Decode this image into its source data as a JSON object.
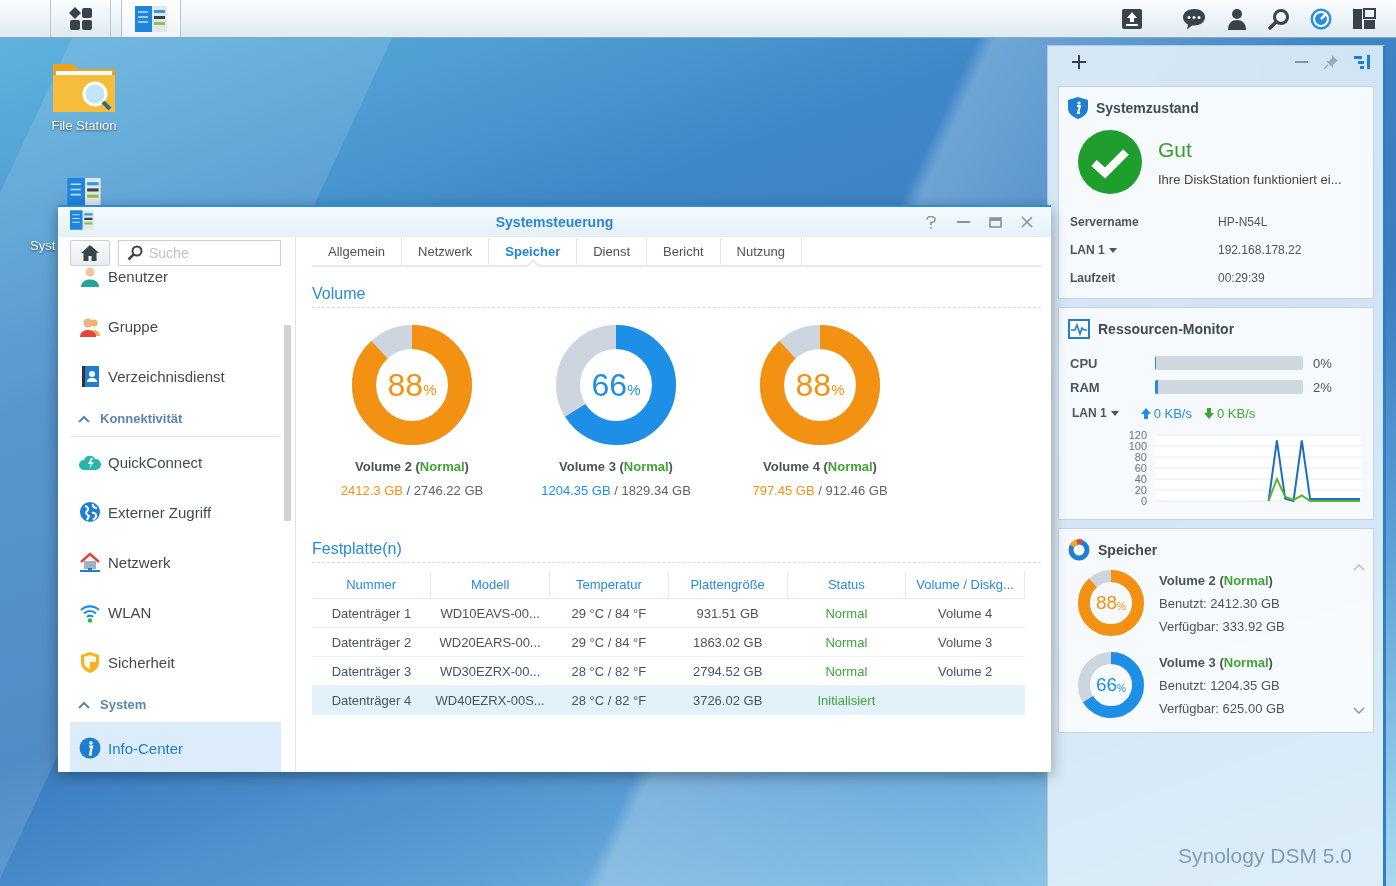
{
  "desktop": {
    "icons": [
      {
        "label": "File Station",
        "kind": "folder"
      },
      {
        "label": "Syst",
        "kind": "control-panel"
      }
    ],
    "brand": "Synology DSM 5.0"
  },
  "window": {
    "title": "Systemsteuerung",
    "search": {
      "placeholder": "Suche"
    },
    "sidebar": {
      "items": [
        {
          "kind": "item",
          "label": "Benutzer",
          "selected": false
        },
        {
          "kind": "item",
          "label": "Gruppe",
          "selected": false
        },
        {
          "kind": "item",
          "label": "Verzeichnisdienst",
          "selected": false
        },
        {
          "kind": "header",
          "label": "Konnektivität",
          "expanded": true
        },
        {
          "kind": "item",
          "label": "QuickConnect",
          "selected": false
        },
        {
          "kind": "item",
          "label": "Externer Zugriff",
          "selected": false
        },
        {
          "kind": "item",
          "label": "Netzwerk",
          "selected": false
        },
        {
          "kind": "item",
          "label": "WLAN",
          "selected": false
        },
        {
          "kind": "item",
          "label": "Sicherheit",
          "selected": false
        },
        {
          "kind": "header",
          "label": "System",
          "expanded": true
        },
        {
          "kind": "item",
          "label": "Info-Center",
          "selected": true
        }
      ]
    },
    "tabs": [
      {
        "label": "Allgemein",
        "selected": false
      },
      {
        "label": "Netzwerk",
        "selected": false
      },
      {
        "label": "Speicher",
        "selected": true
      },
      {
        "label": "Dienst",
        "selected": false
      },
      {
        "label": "Bericht",
        "selected": false
      },
      {
        "label": "Nutzung",
        "selected": false
      }
    ],
    "volume_section": {
      "title": "Volume",
      "volumes": [
        {
          "name": "Volume 2 (*Normal*)",
          "percent": "88",
          "unit": "%",
          "level": 0.88,
          "color": "#f39212",
          "usage": "*2412.3 GB* / 2746.22 GB"
        },
        {
          "name": "Volume 3 (*Normal*)",
          "percent": "66",
          "unit": "%",
          "level": 0.66,
          "color": "#1e8fe6",
          "usage": "*1204.35 GB* / 1829.34 GB"
        },
        {
          "name": "Volume 4 (*Normal*)",
          "percent": "88",
          "unit": "%",
          "level": 0.88,
          "color": "#f39212",
          "usage": "*797.45 GB* / 912.46 GB"
        }
      ]
    },
    "disk_section": {
      "title": "Festplatte(n)",
      "table": {
        "columns": [
          "Nummer",
          "Modell",
          "Temperatur",
          "Plattengröße",
          "Status",
          "Volume / Diskg..."
        ],
        "rows": [
          {
            "cells": [
              "Datenträger 1",
              "WD10EAVS-00...",
              "29 °C / 84 °F",
              "931.51 GB",
              "Normal",
              "Volume 4"
            ],
            "selected": false
          },
          {
            "cells": [
              "Datenträger 2",
              "WD20EARS-00...",
              "29 °C / 84 °F",
              "1863.02 GB",
              "Normal",
              "Volume 3"
            ],
            "selected": false
          },
          {
            "cells": [
              "Datenträger 3",
              "WD30EZRX-00...",
              "28 °C / 82 °F",
              "2794.52 GB",
              "Normal",
              "Volume 2"
            ],
            "selected": false
          },
          {
            "cells": [
              "Datenträger 4",
              "WD40EZRX-00S...",
              "28 °C / 82 °F",
              "3726.02 GB",
              "Initialisiert"
            ],
            "selected": true
          }
        ]
      }
    }
  },
  "widgets": {
    "health": {
      "title": "Systemzustand",
      "status": "Gut",
      "message": "Ihre DiskStation funktioniert ei...",
      "rows": [
        {
          "label": "Servername",
          "value": "HP-N54L",
          "dropdown": false
        },
        {
          "label": "LAN 1",
          "value": "192.168.178.22",
          "dropdown": true
        },
        {
          "label": "Laufzeit",
          "value": "00:29:39",
          "dropdown": false
        }
      ]
    },
    "resources": {
      "title": "Ressourcen-Monitor",
      "meters": [
        {
          "label": "CPU",
          "level": 0,
          "reading": "0%"
        },
        {
          "label": "RAM",
          "level": 0.02,
          "reading": "2%"
        }
      ],
      "network": {
        "label": "LAN 1",
        "upload": "0 KB/s",
        "download": "0 KB/s"
      },
      "chart_data": {
        "type": "line",
        "grid": true,
        "ylim": [
          0,
          120
        ],
        "yticks": [
          0,
          20,
          40,
          60,
          80,
          100,
          120
        ],
        "series": [
          {
            "color": "#1f6fc0",
            "values": [
              null,
              null,
              null,
              null,
              null,
              null,
              null,
              null,
              null,
              null,
              null,
              null,
              null,
              0,
              110,
              4,
              0,
              110,
              3.6,
              3.6,
              3.6,
              3.6,
              3.6,
              3.6,
              3.6
            ]
          },
          {
            "color": "#5ab52f",
            "values": [
              null,
              null,
              null,
              null,
              null,
              null,
              null,
              null,
              null,
              null,
              null,
              null,
              null,
              0,
              40,
              8,
              2,
              10,
              0,
              0,
              0,
              0,
              0,
              0,
              0
            ]
          }
        ]
      }
    },
    "storage": {
      "title": "Speicher",
      "volumes": [
        {
          "name": "Volume 2 (*Normal*)",
          "percent": "88",
          "unit": "%",
          "level": 0.88,
          "color": "#f39212",
          "used": "Benutzt: 2412.30 GB",
          "free": "Verfügbar: 333.92 GB"
        },
        {
          "name": "Volume 3 (*Normal*)",
          "percent": "66",
          "unit": "%",
          "level": 0.66,
          "color": "#1e8fe6",
          "used": "Benutzt: 1204.35 GB",
          "free": "Verfügbar: 625.00 GB"
        }
      ]
    }
  }
}
